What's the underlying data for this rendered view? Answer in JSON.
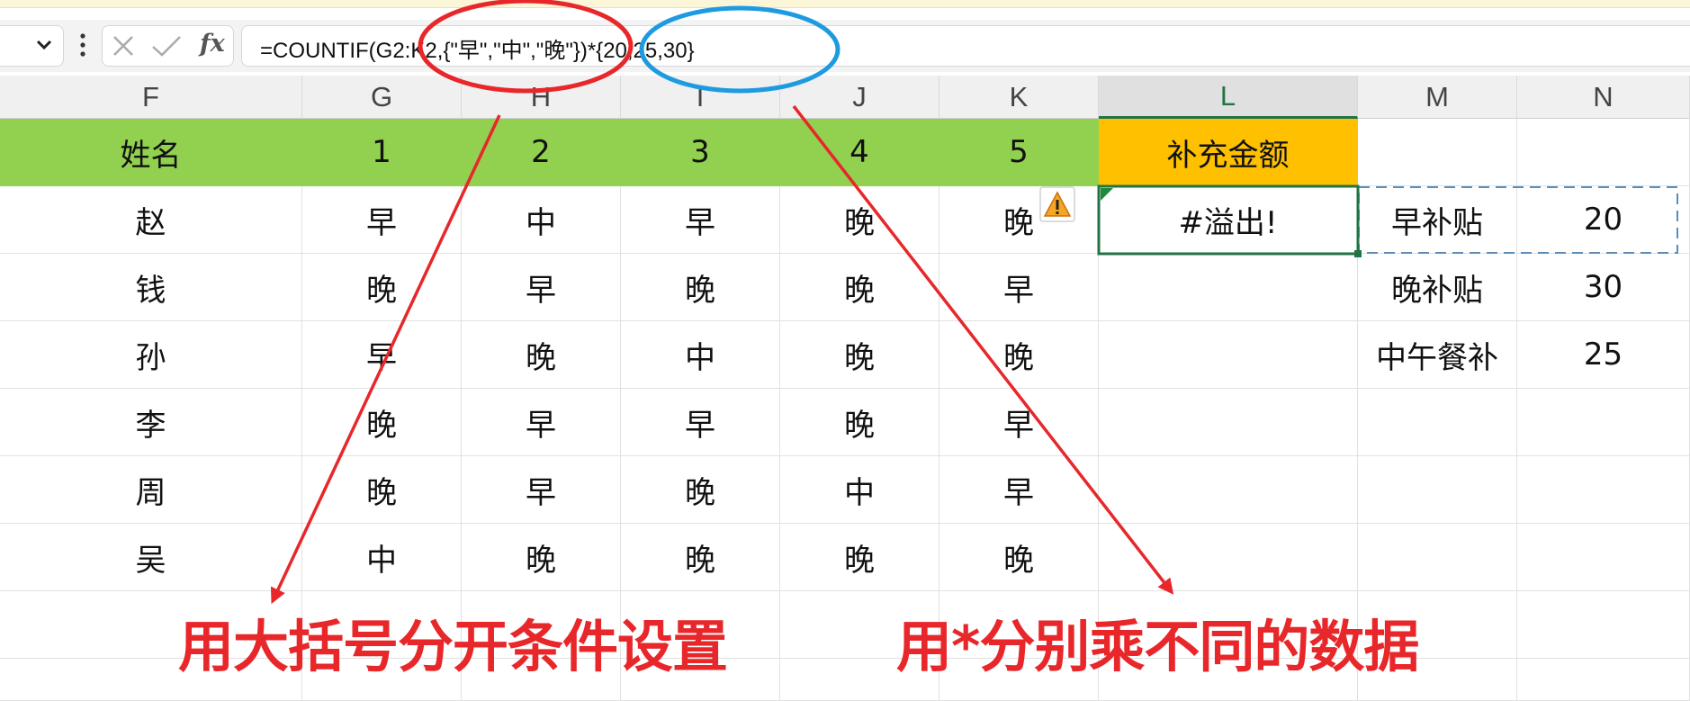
{
  "formula_bar": {
    "formula": "=COUNTIF(G2:K2,{\"早\",\"中\",\"晚\"})*{20,25,30}",
    "fx_label": "fx"
  },
  "columns": [
    "F",
    "G",
    "H",
    "I",
    "J",
    "K",
    "L",
    "M",
    "N"
  ],
  "selected_column": "L",
  "header_row": [
    "姓名",
    "1",
    "2",
    "3",
    "4",
    "5",
    "补充金额"
  ],
  "rows": [
    {
      "name": "赵",
      "shifts": [
        "早",
        "中",
        "早",
        "晚",
        "晚"
      ],
      "result": "#溢出!",
      "label": "早补贴",
      "amount": "20"
    },
    {
      "name": "钱",
      "shifts": [
        "晚",
        "早",
        "晚",
        "晚",
        "早"
      ],
      "result": "",
      "label": "晚补贴",
      "amount": "30"
    },
    {
      "name": "孙",
      "shifts": [
        "早",
        "晚",
        "中",
        "晚",
        "晚"
      ],
      "result": "",
      "label": "中午餐补",
      "amount": "25"
    },
    {
      "name": "李",
      "shifts": [
        "晚",
        "早",
        "早",
        "晚",
        "早"
      ],
      "result": "",
      "label": "",
      "amount": ""
    },
    {
      "name": "周",
      "shifts": [
        "晚",
        "早",
        "晚",
        "中",
        "早"
      ],
      "result": "",
      "label": "",
      "amount": ""
    },
    {
      "name": "吴",
      "shifts": [
        "中",
        "晚",
        "晚",
        "晚",
        "晚"
      ],
      "result": "",
      "label": "",
      "amount": ""
    }
  ],
  "annotations": {
    "left": "用大括号分开条件设置",
    "right": "用*分别乘不同的数据"
  },
  "colors": {
    "header_green": "#92d050",
    "header_orange": "#ffc000",
    "annotation_red": "#e8272b",
    "annotation_blue": "#1e9be0",
    "selection_green": "#217346"
  },
  "icons": [
    "chevron-down-icon",
    "more-vertical-icon",
    "cancel-x-icon",
    "confirm-check-icon",
    "fx-icon",
    "warning-icon"
  ]
}
